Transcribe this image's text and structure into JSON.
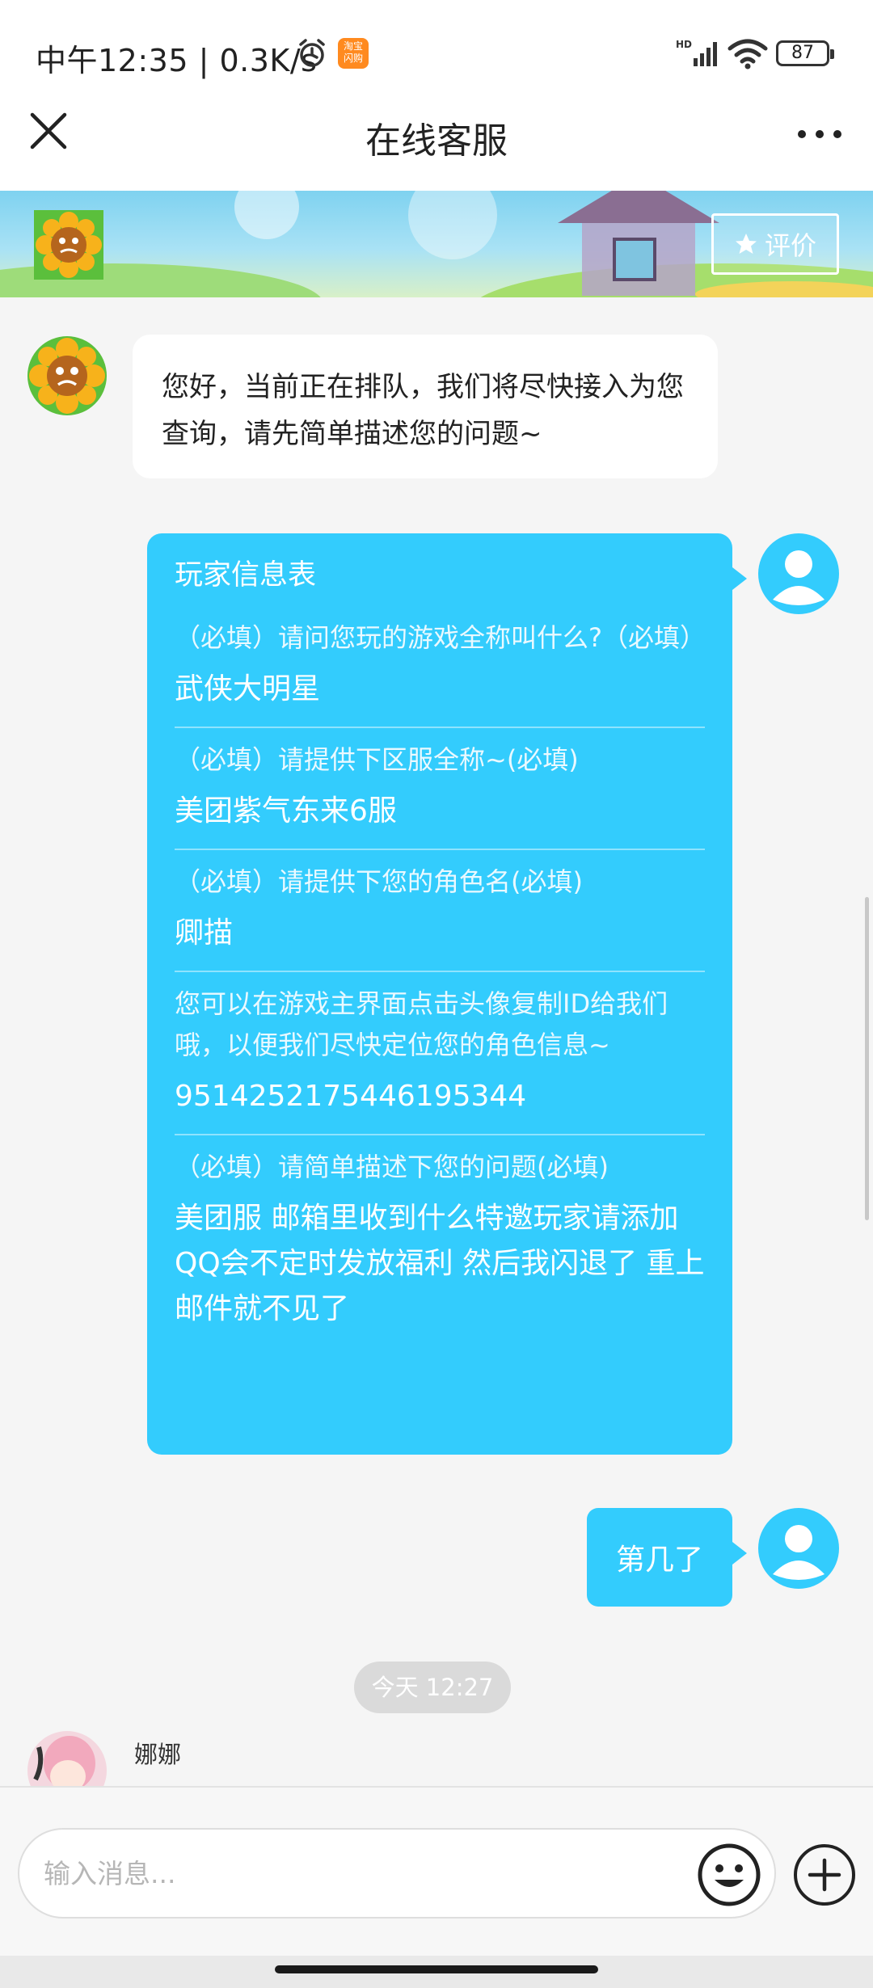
{
  "status_bar": {
    "time": "中午12:35 | 0.3K/s",
    "taobao_icon_text": "淘宝\n闪购",
    "battery": "87",
    "icons": [
      "alarm-icon",
      "taobao-flash-icon",
      "signal-icon",
      "wifi-icon",
      "battery-icon"
    ]
  },
  "header": {
    "title": "在线客服",
    "close_icon": "close-icon",
    "more_icon": "more-dots-icon"
  },
  "banner": {
    "rate_label": "评价",
    "rate_icon": "star-icon"
  },
  "messages": [
    {
      "from": "service",
      "text": "您好，当前正在排队，我们将尽快接入为您查询，请先简单描述您的问题~"
    },
    {
      "from": "user",
      "type": "form",
      "title": "玩家信息表",
      "items": [
        {
          "q": "（必填）请问您玩的游戏全称叫什么?（必填）",
          "a": "武侠大明星"
        },
        {
          "q": "（必填）请提供下区服全称~(必填)",
          "a": "美团紫气东来6服"
        },
        {
          "q": "（必填）请提供下您的角色名(必填)",
          "a": "卿描"
        },
        {
          "q": "您可以在游戏主界面点击头像复制ID给我们哦，以便我们尽快定位您的角色信息~",
          "a": "9514252175446195344"
        },
        {
          "q": "（必填）请简单描述下您的问题(必填)",
          "a": "美团服 邮箱里收到什么特邀玩家请添加QQ会不定时发放福利 然后我闪退了 重上邮件就不见了"
        }
      ]
    },
    {
      "from": "user",
      "text": "第几了"
    }
  ],
  "timestamp": "今天 12:27",
  "agent": {
    "name": "娜娜"
  },
  "input": {
    "placeholder": "输入消息...",
    "value": "",
    "emoji_icon": "emoji-icon",
    "plus_icon": "plus-icon"
  },
  "colors": {
    "accent": "#33ccfd",
    "bubble_in": "#ffffff",
    "background": "#f5f5f5",
    "timestamp_pill": "#dadada"
  }
}
